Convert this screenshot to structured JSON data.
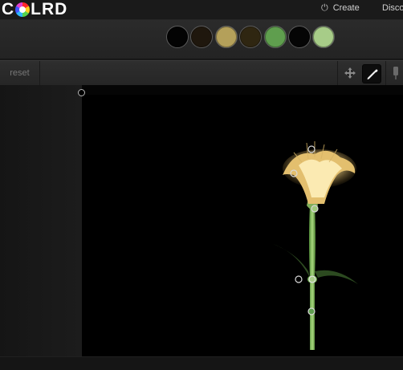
{
  "header": {
    "logo": {
      "letter_c": "C",
      "letters_rest": "LRD",
      "icon": "color-wheel-icon"
    },
    "create_label": "Create",
    "create_icon": "power-icon",
    "discover_label": "Disco"
  },
  "palette": {
    "swatches": [
      "#030303",
      "#1f170d",
      "#b4a05a",
      "#2f2611",
      "#5f9e4e",
      "#050505",
      "#a7cc88"
    ]
  },
  "toolbar": {
    "reset_label": "reset",
    "tools": [
      "move-icon",
      "eyedropper-icon",
      "side-tool-icon"
    ],
    "active_tool": "eyedropper-icon"
  },
  "canvas": {
    "image_subject": "flower",
    "picker_count": 7
  }
}
